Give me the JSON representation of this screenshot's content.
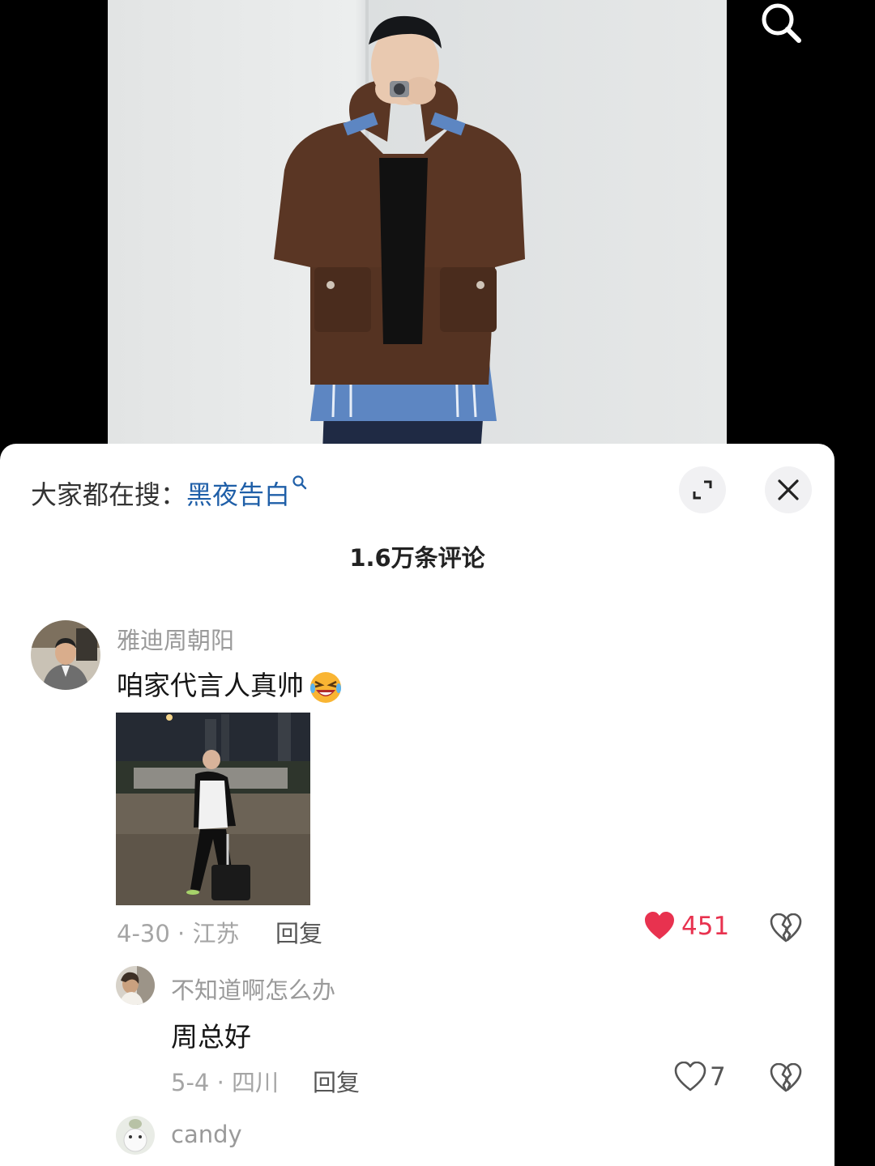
{
  "hot_search": {
    "prefix": "大家都在搜：",
    "keyword": "黑夜告白"
  },
  "comment_count": "1.6万条评论",
  "comments": [
    {
      "user": "雅迪周朝阳",
      "text": "咱家代言人真帅",
      "emoji": "laughing-crying-emoji",
      "has_media": true,
      "meta": "4-30 · 江苏",
      "reply_label": "回复",
      "likes": "451",
      "liked": true
    }
  ],
  "replies": [
    {
      "user": "不知道啊怎么办",
      "text": "周总好",
      "meta": "5-4 · 四川",
      "reply_label": "回复",
      "likes": "7",
      "liked": false
    },
    {
      "user": "candy"
    }
  ],
  "colors": {
    "keyword": "#1f5fa8",
    "like_active": "#e8324f",
    "muted": "#9a9a9a"
  }
}
